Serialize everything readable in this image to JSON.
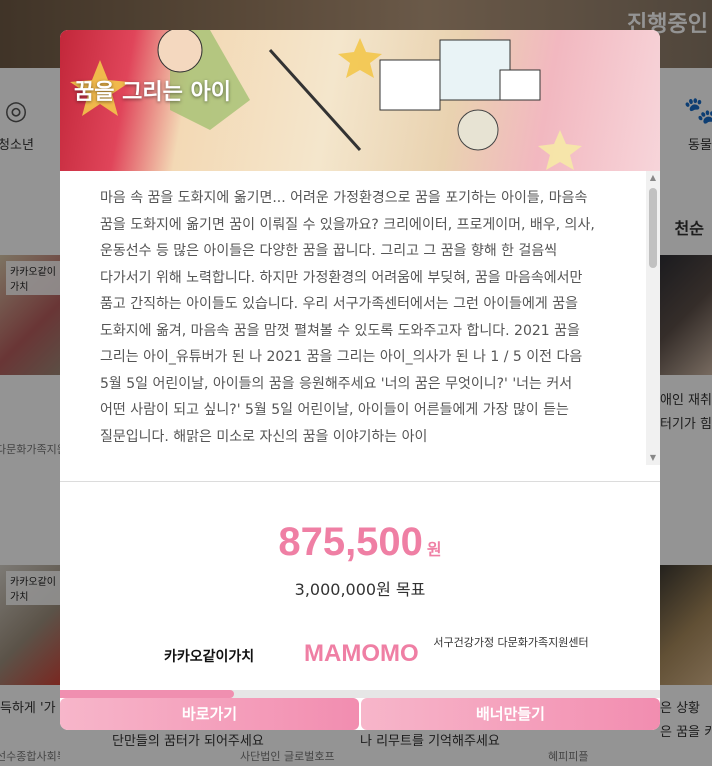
{
  "background": {
    "hero_title": "진행중인",
    "categories": [
      {
        "label": "청소년",
        "icon": "youth-icon"
      },
      {
        "label": "동물",
        "icon": "paw-icon"
      }
    ],
    "section_title": "천순",
    "cards": [
      {
        "tag": "카카오같이가치",
        "org": "다문화가족지원"
      },
      {
        "tag": "",
        "text1": "애인 재취",
        "text2": "터기가 힘"
      },
      {
        "tag": "카카오같이가치",
        "title": "득하게 '가",
        "org": "선수종합사회복지관"
      },
      {
        "title": "단만들의 꿈터가 되어주세요",
        "org": "사단법인 글로벌호프"
      },
      {
        "title": "나 리무트를 기억해주세요",
        "org": "혜피피플"
      },
      {
        "title": "은 상황",
        "title2": "은 꿈을 키워가"
      }
    ]
  },
  "modal": {
    "title": "꿈을 그리는 아이",
    "description": "마음 속 꿈을 도화지에 옮기면... 어려운 가정환경으로 꿈을 포기하는 아이들, 마음속 꿈을 도화지에 옮기면 꿈이 이뤄질 수 있을까요? 크리에이터, 프로게이머, 배우, 의사, 운동선수 등 많은 아이들은 다양한 꿈을 꿉니다. 그리고 그 꿈을 향해 한 걸음씩 다가서기 위해 노력합니다. 하지만 가정환경의 어려움에 부딪혀, 꿈을 마음속에서만 품고 간직하는 아이들도 있습니다. 우리 서구가족센터에서는 그런 아이들에게 꿈을 도화지에 옮겨, 마음속 꿈을 맘껏 펼쳐볼 수 있도록 도와주고자 합니다. 2021 꿈을 그리는 아이_유튜버가 된 나 2021 꿈을 그리는 아이_의사가 된 나 1 / 5 이전 다음 5월 5일 어린이날, 아이들의 꿈을 응원해주세요 '너의 꿈은 무엇이니?' '너는 커서 어떤 사람이 되고 싶니?' 5월 5일 어린이날, 아이들이 어른들에게 가장 많이 듣는 질문입니다. 해맑은 미소로 자신의 꿈을 이야기하는 아이",
    "amount": "875,500",
    "amount_unit": "원",
    "goal": "3,000,000원 목표",
    "progress_fraction": 0.29,
    "partners": {
      "kakao_prefix": "카카오",
      "kakao_bold": "같이가치",
      "mamomo": "MAMOMO",
      "center": "서구건강가정 다문화가족지원센터"
    },
    "buttons": {
      "go": "바로가기",
      "banner": "배너만들기"
    },
    "colors": {
      "accent": "#ef7fa4",
      "button_start": "#f7b6ca",
      "button_end": "#f28db0"
    }
  }
}
